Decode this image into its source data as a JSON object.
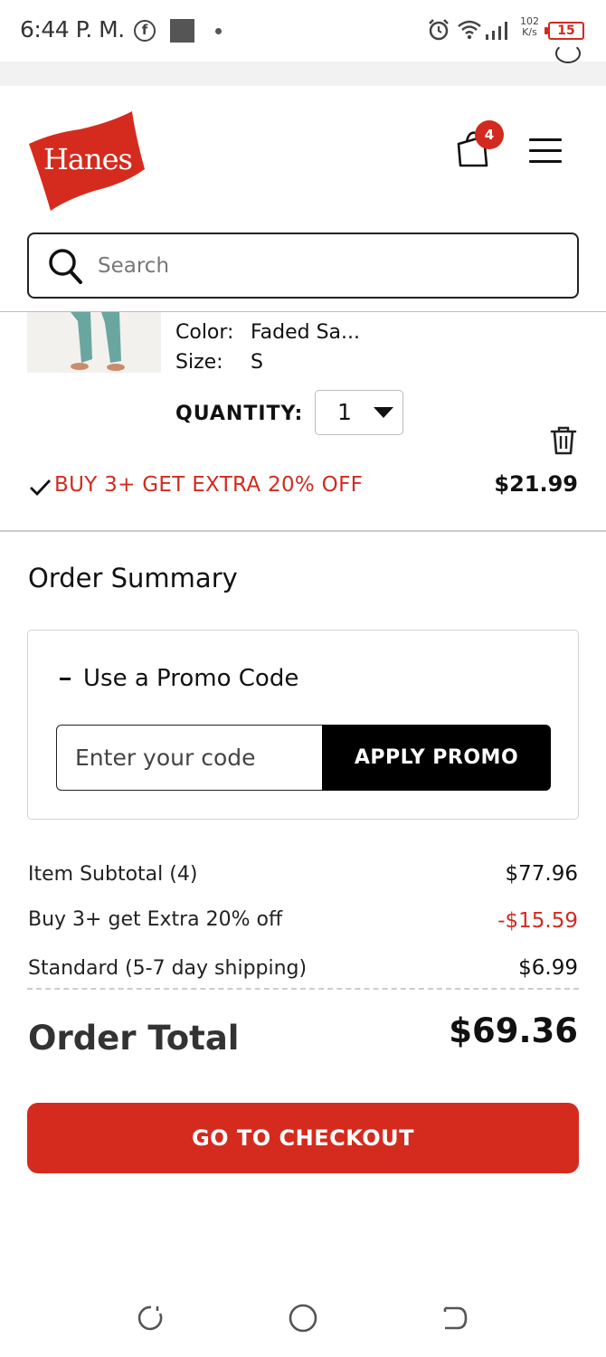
{
  "status_bar": {
    "time": "6:44 P. M.",
    "net_speed_top": "102",
    "net_speed_bottom": "K/s",
    "battery": "15"
  },
  "header": {
    "logo_text": "Hanes",
    "cart_count": "4",
    "search_placeholder": "Search"
  },
  "product": {
    "color_label": "Color:",
    "color_value": "Faded Sa...",
    "size_label": "Size:",
    "size_value": "S",
    "quantity_label": "QUANTITY:",
    "quantity_value": "1",
    "promo_text": "BUY 3+ GET EXTRA 20% OFF",
    "price": "$21.99"
  },
  "summary": {
    "title": "Order Summary",
    "promo_toggle": "-",
    "promo_label": "Use a Promo Code",
    "promo_placeholder": "Enter your code",
    "apply_label": "APPLY PROMO",
    "lines": [
      {
        "label": "Item Subtotal (4)",
        "value": "$77.96"
      },
      {
        "label": "Buy 3+ get Extra 20% off",
        "value": "-$15.59"
      },
      {
        "label": "Standard (5-7 day shipping)",
        "value": "$6.99"
      }
    ],
    "total_label": "Order Total",
    "total_value": "$69.36",
    "checkout_label": "GO TO CHECKOUT"
  },
  "colors": {
    "brand_red": "#d52b1e",
    "discount_red": "#d32a1f",
    "black": "#000000"
  },
  "icons": [
    "facebook-icon",
    "alarm-icon",
    "wifi-icon",
    "signal-icon",
    "battery-icon",
    "cart-icon",
    "menu-icon",
    "search-icon",
    "trash-icon",
    "check-icon",
    "recents-icon",
    "home-icon",
    "back-icon"
  ]
}
